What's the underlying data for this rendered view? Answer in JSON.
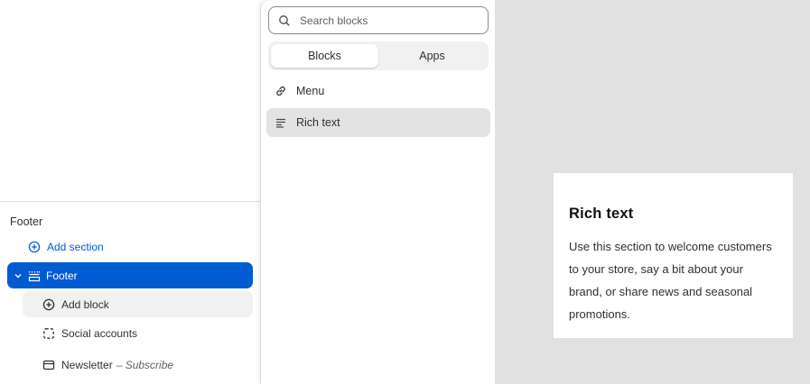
{
  "sidebar": {
    "group_title": "Footer",
    "add_section_label": "Add section",
    "footer_section_label": "Footer",
    "add_block_label": "Add block",
    "blocks": [
      {
        "label": "Social accounts",
        "icon": "dashed-square-icon"
      },
      {
        "label": "Newsletter",
        "suffix": "– Subscribe",
        "icon": "mail-icon"
      }
    ]
  },
  "picker": {
    "search_placeholder": "Search blocks",
    "tabs": [
      {
        "label": "Blocks",
        "active": true
      },
      {
        "label": "Apps",
        "active": false
      }
    ],
    "items": [
      {
        "label": "Menu",
        "icon": "link-icon"
      },
      {
        "label": "Rich text",
        "icon": "text-align-icon",
        "hovered": true
      }
    ]
  },
  "preview": {
    "title": "Rich text",
    "body": "Use this section to welcome customers to your store, say a bit about your brand, or share news and seasonal promotions."
  },
  "colors": {
    "accent": "#005bd3",
    "preview_bg": "#e1e1e1",
    "hover_bg": "#e3e3e3"
  }
}
